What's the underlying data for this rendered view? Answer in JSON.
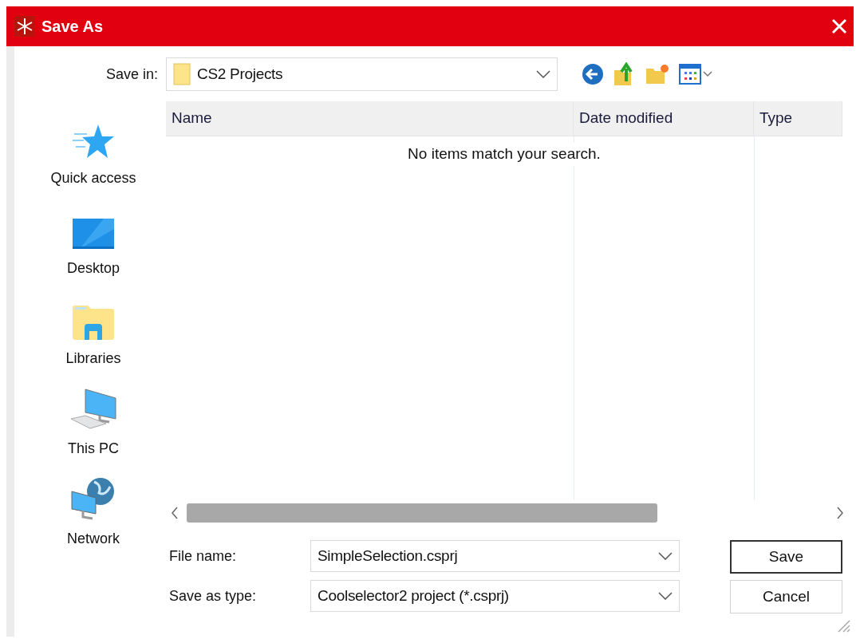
{
  "window": {
    "title": "Save As"
  },
  "save_in": {
    "label": "Save in:",
    "value": "CS2 Projects"
  },
  "places": [
    {
      "label": "Quick access"
    },
    {
      "label": "Desktop"
    },
    {
      "label": "Libraries"
    },
    {
      "label": "This PC"
    },
    {
      "label": "Network"
    }
  ],
  "table": {
    "columns": [
      "Name",
      "Date modified",
      "Type"
    ],
    "empty_message": "No items match your search."
  },
  "file_name": {
    "label": "File name:",
    "value": "SimpleSelection.csprj"
  },
  "save_as_type": {
    "label": "Save as type:",
    "value": "Coolselector2 project (*.csprj)"
  },
  "buttons": [
    {
      "label": "Save",
      "default": true
    },
    {
      "label": "Cancel",
      "default": false
    }
  ]
}
